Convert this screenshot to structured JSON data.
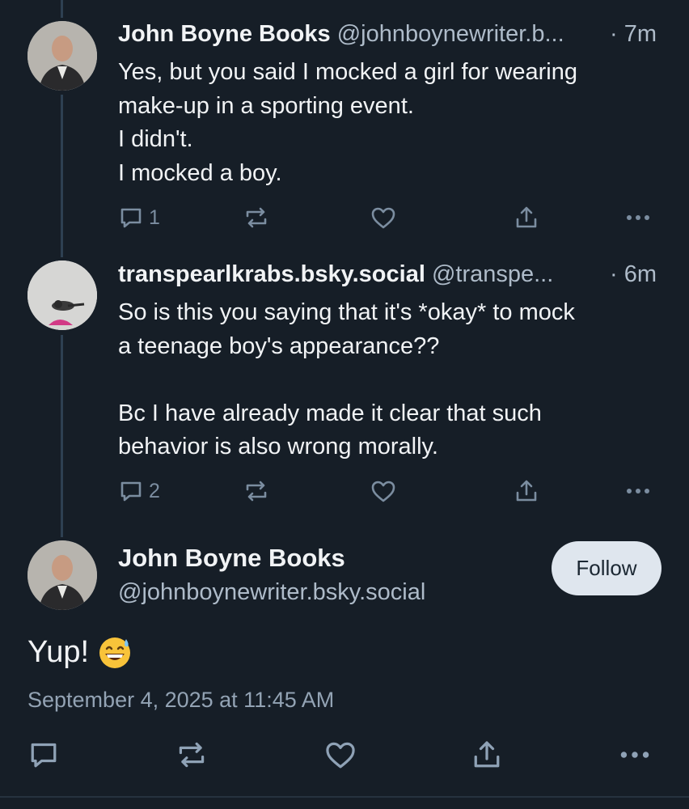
{
  "thread": {
    "replies": [
      {
        "author_name": "John Boyne Books",
        "handle": "@johnboynewriter.b...",
        "time": "· 7m",
        "lines": [
          "Yes, but you said I mocked a girl for wearing",
          "make-up in a sporting event.",
          "I didn't.",
          "I mocked a boy."
        ],
        "reply_count": "1",
        "avatar": "person-photo"
      },
      {
        "author_name": "transpearlkrabs.bsky.social",
        "handle": "@transpe...",
        "time": "· 6m",
        "lines": [
          "So is this you saying that it's *okay* to mock",
          "a teenage boy's appearance??",
          "",
          "Bc I have already made it clear that such",
          "behavior is also wrong morally."
        ],
        "reply_count": "2",
        "avatar": "cat-photo"
      }
    ]
  },
  "main_post": {
    "author_name": "John Boyne Books",
    "handle": "@johnboynewriter.bsky.social",
    "follow_label": "Follow",
    "text": "Yup!",
    "emoji": "grinning-face-with-sweat",
    "date": "September 4, 2025 at 11:45 AM"
  },
  "colors": {
    "background": "#161e27",
    "thread_line": "#2e4052",
    "secondary_text": "#aebbc9",
    "icon": "#7b8da0",
    "follow_bg": "#dfe6ee"
  },
  "icons": [
    "reply-icon",
    "repost-icon",
    "like-icon",
    "share-icon",
    "more-icon"
  ]
}
